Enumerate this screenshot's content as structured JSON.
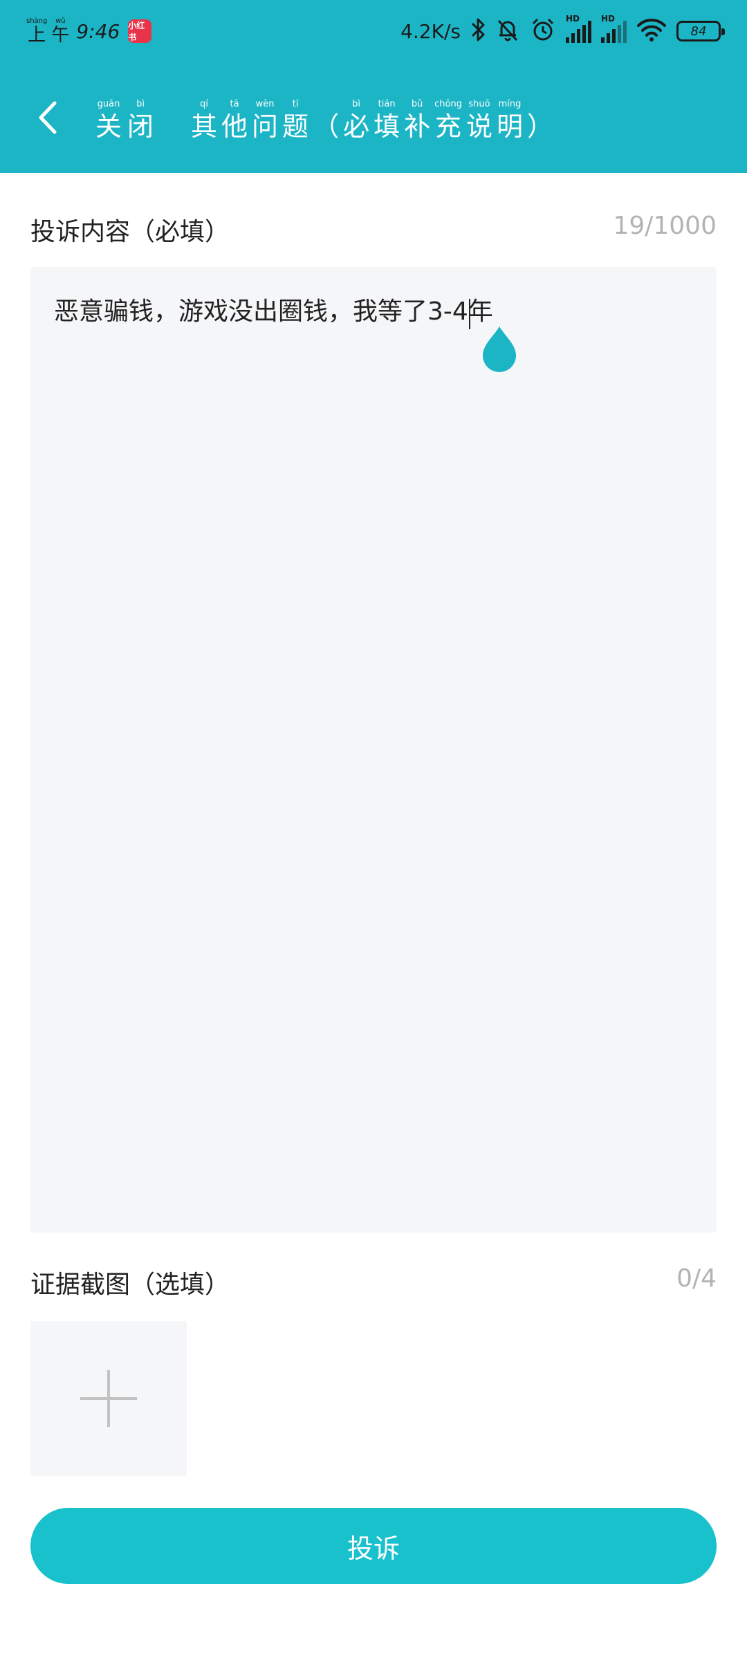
{
  "status_bar": {
    "ampm_chars": [
      {
        "pinyin": "shàng",
        "char": "上"
      },
      {
        "pinyin": "wǔ",
        "char": "午"
      }
    ],
    "time": "9:46",
    "app_badge": "小红书",
    "net_speed": "4.2K/s",
    "signal_label_1": "HD",
    "signal_label_2": "HD",
    "battery": "84"
  },
  "header": {
    "close_chars": [
      {
        "pinyin": "guān",
        "char": "关"
      },
      {
        "pinyin": "bì",
        "char": "闭"
      }
    ],
    "title_chars": [
      {
        "pinyin": "qí",
        "char": "其"
      },
      {
        "pinyin": "tā",
        "char": "他"
      },
      {
        "pinyin": "wèn",
        "char": "问"
      },
      {
        "pinyin": "tí",
        "char": "题"
      },
      {
        "pinyin": "",
        "char": "（"
      },
      {
        "pinyin": "bì",
        "char": "必"
      },
      {
        "pinyin": "tián",
        "char": "填"
      },
      {
        "pinyin": "bǔ",
        "char": "补"
      },
      {
        "pinyin": "chōng",
        "char": "充"
      },
      {
        "pinyin": "shuō",
        "char": "说"
      },
      {
        "pinyin": "míng",
        "char": "明"
      },
      {
        "pinyin": "",
        "char": "）"
      }
    ]
  },
  "complaint": {
    "label": "投诉内容（必填）",
    "count": "19/1000",
    "text": "恶意骗钱，游戏没出圈钱，我等了3-4年"
  },
  "evidence": {
    "label": "证据截图（选填）",
    "count": "0/4"
  },
  "submit": {
    "label": "投诉"
  },
  "colors": {
    "header_bg": "#1CB5C6",
    "button_bg": "#18C1CC",
    "field_bg": "#F5F6F8",
    "muted_text": "#B3B3B3"
  }
}
